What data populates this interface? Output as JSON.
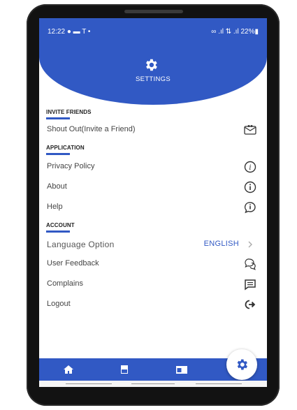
{
  "status_bar": {
    "time": "12:22",
    "right": "22%"
  },
  "header": {
    "title": "SETTINGS",
    "icon": "gear-icon",
    "color": "#3159c4"
  },
  "sections": {
    "invite": {
      "title": "INVITE FRIENDS",
      "items": [
        {
          "label": "Shout Out(Invite a Friend)",
          "icon": "invite-envelope-icon"
        }
      ]
    },
    "application": {
      "title": "APPLICATION",
      "items": [
        {
          "label": "Privacy Policy",
          "icon": "privacy-info-icon"
        },
        {
          "label": "About",
          "icon": "about-info-icon"
        },
        {
          "label": "Help",
          "icon": "help-chat-icon"
        }
      ]
    },
    "account": {
      "title": "ACCOUNT",
      "items": [
        {
          "label": "Language Option",
          "value": "ENGLISH",
          "icon": "chevron-right-icon"
        },
        {
          "label": "User Feedback",
          "icon": "feedback-chat-icon"
        },
        {
          "label": "Complains",
          "icon": "complaint-message-icon"
        },
        {
          "label": "Logout",
          "icon": "logout-icon"
        }
      ]
    }
  },
  "bottom_nav": {
    "items": [
      "home-icon",
      "book-icon",
      "card-icon"
    ],
    "active": "gear-icon",
    "color": "#3159c4"
  }
}
